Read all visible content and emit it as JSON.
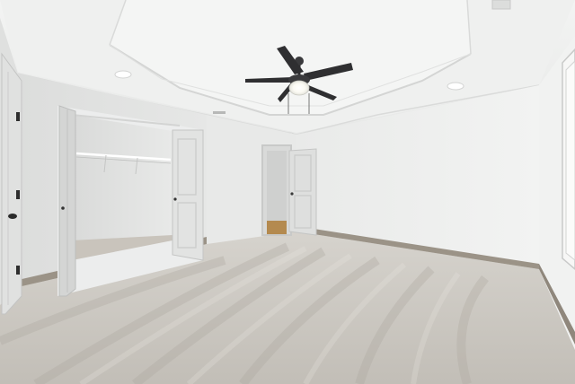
{
  "scene": {
    "kind": "photo",
    "subject": "empty-bedroom",
    "elements": [
      "tray-ceiling",
      "ceiling-fan",
      "recessed-lights",
      "walk-in-closet-double-doors",
      "hallway-door",
      "bedroom-door",
      "window",
      "carpet-floor",
      "baseboards"
    ]
  },
  "colors": {
    "wall": "#ecedec",
    "ceiling": "#f1f2f1",
    "carpet": "#cbc7c0",
    "baseboard": "#9b9387",
    "door": "#dedfde",
    "fan": "#2f2f31",
    "hall_floor": "#b48a4f"
  }
}
